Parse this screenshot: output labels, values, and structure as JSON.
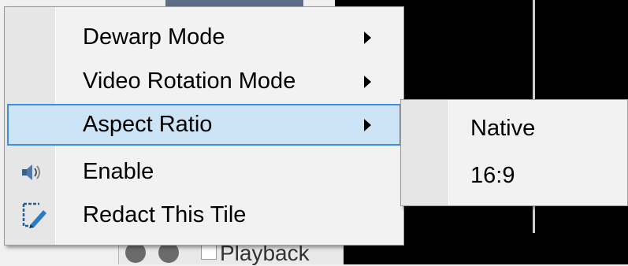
{
  "context_menu": {
    "items": [
      {
        "label": "Dewarp Mode",
        "has_submenu": true,
        "icon": null
      },
      {
        "label": "Video Rotation Mode",
        "has_submenu": true,
        "icon": null
      },
      {
        "label": "Aspect Ratio",
        "has_submenu": true,
        "highlighted": true,
        "icon": null
      },
      {
        "label": "Enable",
        "has_submenu": false,
        "icon": "speaker-icon"
      },
      {
        "label": "Redact This Tile",
        "has_submenu": false,
        "icon": "redact-pencil-icon"
      }
    ]
  },
  "submenu": {
    "items": [
      {
        "label": "Native"
      },
      {
        "label": "16:9"
      }
    ]
  },
  "background": {
    "playback_label": "Playback"
  },
  "colors": {
    "highlight_fill": "#cde4f7",
    "highlight_border": "#3d8fdd",
    "menu_bg": "#f2f2f2",
    "gutter_bg": "#e6e6e6"
  }
}
